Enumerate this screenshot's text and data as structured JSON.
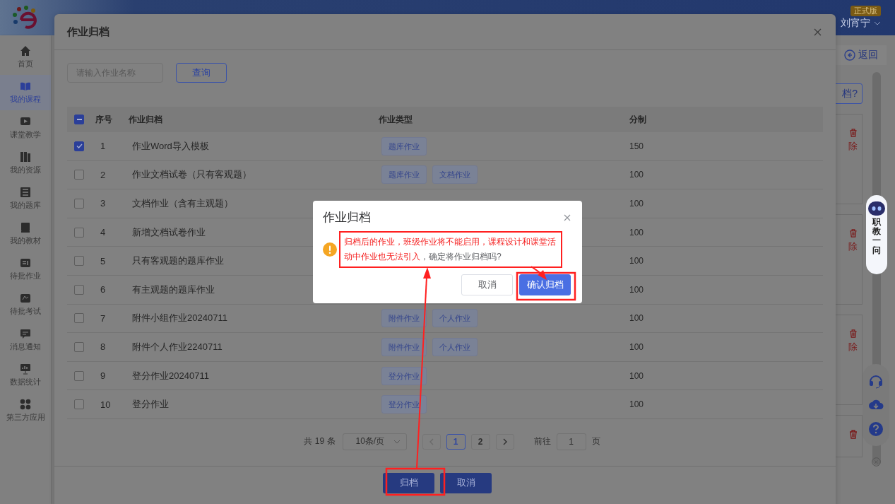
{
  "header": {
    "badge": "正式版",
    "user_name": "刘宵宁"
  },
  "sidebar": {
    "items": [
      {
        "label": "首页",
        "selected": false
      },
      {
        "label": "我的课程",
        "selected": true
      },
      {
        "label": "课堂教学",
        "selected": false
      },
      {
        "label": "我的资源",
        "selected": false
      },
      {
        "label": "我的题库",
        "selected": false
      },
      {
        "label": "我的教材",
        "selected": false
      },
      {
        "label": "待批作业",
        "selected": false
      },
      {
        "label": "待批考试",
        "selected": false
      },
      {
        "label": "消息通知",
        "selected": false
      },
      {
        "label": "数据统计",
        "selected": false
      },
      {
        "label": "第三方应用",
        "selected": false
      }
    ]
  },
  "page": {
    "back_button": "返回",
    "partial_button": "档?",
    "cards": [
      {
        "action": "除"
      },
      {
        "action": "除"
      },
      {
        "action": "除"
      }
    ]
  },
  "assistant": {
    "label": "职教一问"
  },
  "modal": {
    "title": "作业归档",
    "search": {
      "placeholder": "请输入作业名称"
    },
    "query_button": "查询",
    "table": {
      "indeterminate": true,
      "columns": [
        "序号",
        "作业归档",
        "作业类型",
        "分制"
      ],
      "rows": [
        {
          "index": "1",
          "name": "作业Word导入模板",
          "tags": [
            "题库作业"
          ],
          "score": "150",
          "checked": true
        },
        {
          "index": "2",
          "name": "作业文档试卷（只有客观题）",
          "tags": [
            "题库作业",
            "文档作业"
          ],
          "score": "100",
          "checked": false
        },
        {
          "index": "3",
          "name": "文档作业（含有主观题）",
          "tags": [],
          "score": "100",
          "checked": false
        },
        {
          "index": "4",
          "name": "新增文档试卷作业",
          "tags": [],
          "score": "100",
          "checked": false
        },
        {
          "index": "5",
          "name": "只有客观题的题库作业",
          "tags": [],
          "score": "100",
          "checked": false
        },
        {
          "index": "6",
          "name": "有主观题的题库作业",
          "tags": [],
          "score": "100",
          "checked": false
        },
        {
          "index": "7",
          "name": "附件小组作业20240711",
          "tags": [
            "附件作业",
            "个人作业"
          ],
          "score": "100",
          "checked": false
        },
        {
          "index": "8",
          "name": "附件个人作业2240711",
          "tags": [
            "附件作业",
            "个人作业"
          ],
          "score": "100",
          "checked": false
        },
        {
          "index": "9",
          "name": "登分作业20240711",
          "tags": [
            "登分作业"
          ],
          "score": "100",
          "checked": false
        },
        {
          "index": "10",
          "name": "登分作业",
          "tags": [
            "登分作业"
          ],
          "score": "100",
          "checked": false
        }
      ]
    },
    "pagination": {
      "total": "共 19 条",
      "page_size": "10条/页",
      "prev_disabled": true,
      "next_disabled": false,
      "pages": [
        {
          "label": "1",
          "selected": true
        },
        {
          "label": "2",
          "selected": false
        }
      ],
      "goto_label": "前往",
      "goto_value": "1",
      "goto_suffix": "页"
    },
    "footer_buttons": [
      "归档",
      "取消"
    ]
  },
  "confirm": {
    "title": "作业归档",
    "warning": "归档后的作业，班级作业将不能启用，课程设计和课堂活动中作业也无法引入",
    "question": "，确定将作业归档吗?",
    "buttons": [
      {
        "label": "取消",
        "kind": "plain"
      },
      {
        "label": "确认归档",
        "kind": "primary"
      }
    ]
  }
}
